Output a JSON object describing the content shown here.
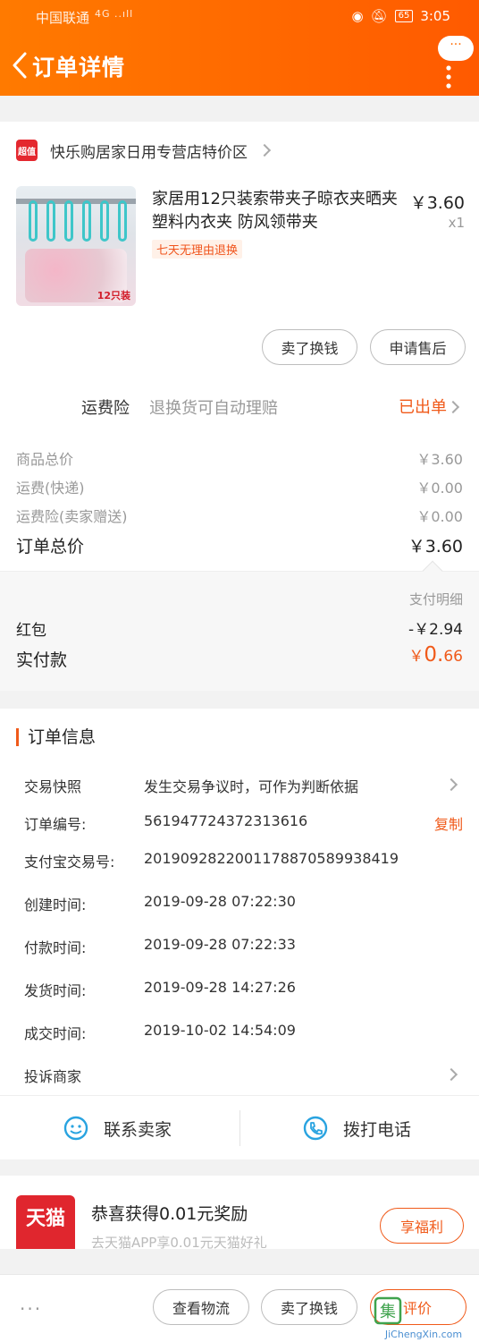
{
  "status_bar": {
    "carrier": "中国联通",
    "network_icons": "4G ..ıll",
    "battery": "65",
    "time": "3:05"
  },
  "nav": {
    "title": "订单详情",
    "more_bubble": "···"
  },
  "shop": {
    "badge": "超值",
    "name": "快乐购居家日用专营店特价区"
  },
  "product": {
    "title": "家居用12只装索带夹子晾衣夹晒夹 塑料内衣夹 防风领带夹",
    "refund_tag": "七天无理由退换",
    "price": "￥3.60",
    "qty": "x1",
    "image_tag": "12只装"
  },
  "item_actions": {
    "resell": "卖了换钱",
    "after_sale": "申请售后"
  },
  "insurance": {
    "label": "运费险",
    "desc": "退换货可自动理赔",
    "status": "已出单"
  },
  "fees": [
    {
      "label": "商品总价",
      "value": "￥3.60"
    },
    {
      "label": "运费(快递)",
      "value": "￥0.00"
    },
    {
      "label": "运费险(卖家赠送)",
      "value": "￥0.00"
    }
  ],
  "order_total": {
    "label": "订单总价",
    "value": "￥3.60"
  },
  "payment": {
    "detail_link": "支付明细",
    "redpacket_label": "红包",
    "redpacket_value": "-￥2.94",
    "actual_label": "实付款",
    "actual_symbol": "￥",
    "actual_int": "0.",
    "actual_dec": "66"
  },
  "order_info": {
    "title": "订单信息",
    "snapshot_label": "交易快照",
    "snapshot_desc": "发生交易争议时，可作为判断依据",
    "order_no_label": "订单编号:",
    "order_no": "561947724372313616",
    "copy": "复制",
    "alipay_label": "支付宝交易号:",
    "alipay_no": "2019092822001178870589938419",
    "created_label": "创建时间:",
    "created": "2019-09-28 07:22:30",
    "paid_label": "付款时间:",
    "paid": "2019-09-28 07:22:33",
    "shipped_label": "发货时间:",
    "shipped": "2019-09-28 14:27:26",
    "completed_label": "成交时间:",
    "completed": "2019-10-02 14:54:09",
    "complaint": "投诉商家"
  },
  "contact": {
    "seller": "联系卖家",
    "phone": "拨打电话"
  },
  "promo": {
    "logo": "天猫",
    "title": "恭喜获得0.01元奖励",
    "subtitle": "去天猫APP享0.01元天猫好礼",
    "button": "享福利"
  },
  "bottom_actions": {
    "more": "···",
    "logistics": "查看物流",
    "resell": "卖了换钱",
    "review": "评价"
  },
  "watermark": {
    "text": "JiChengXin.com",
    "logo_char": "集"
  },
  "colors": {
    "header_orange": "#ff6a00",
    "accent": "#f05a1a",
    "tmall_red": "#e0262e"
  }
}
